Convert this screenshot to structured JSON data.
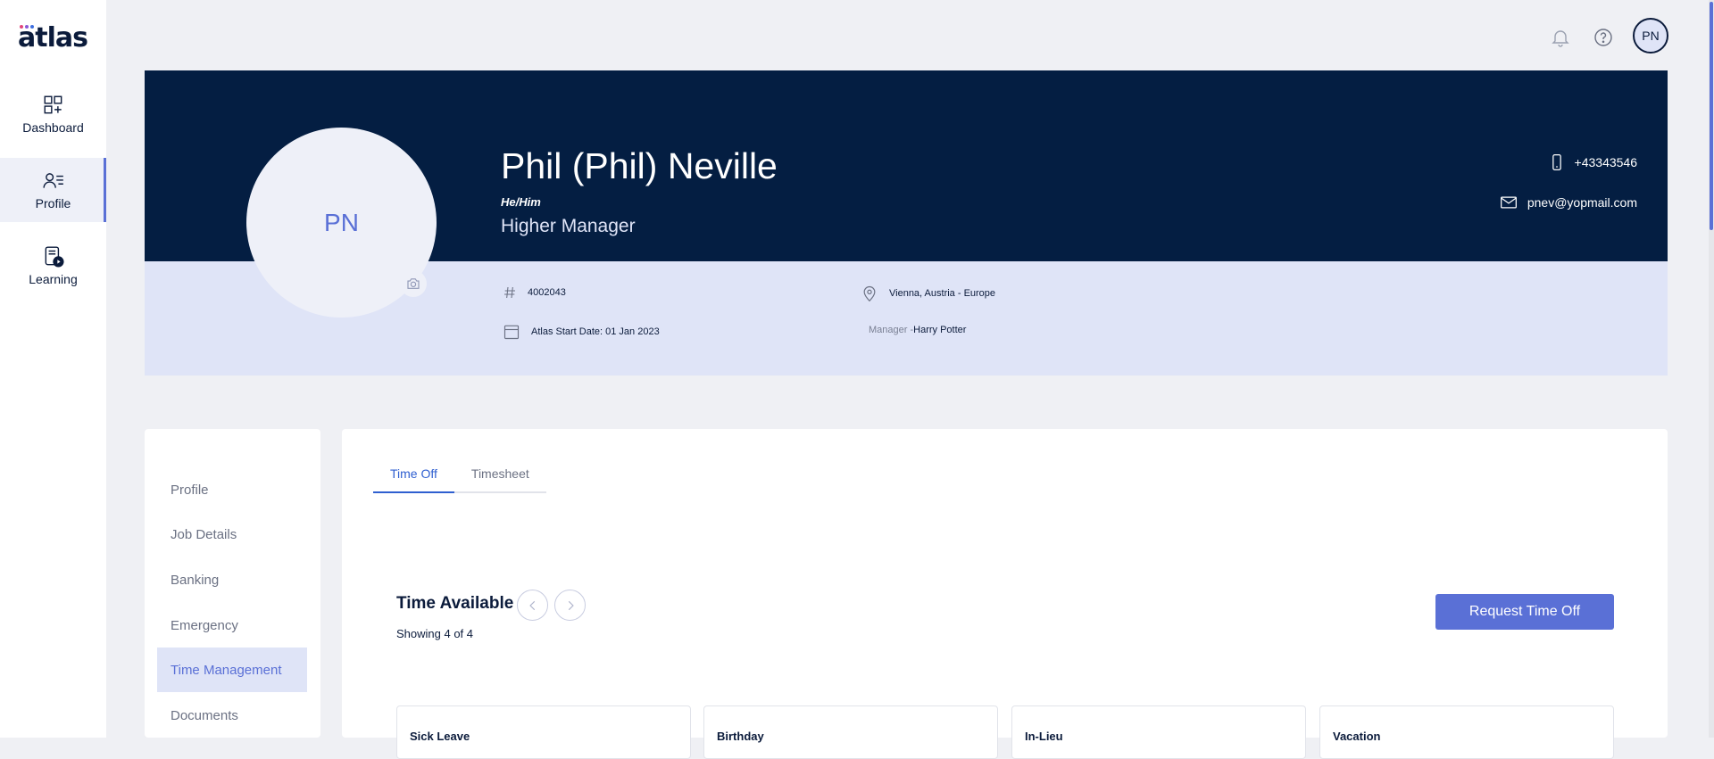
{
  "brand": {
    "logo_text": "atlas",
    "dot_colors": [
      "#e2457b",
      "#8a5ad8",
      "#3f6fe0"
    ]
  },
  "sidebar": {
    "items": [
      {
        "label": "Dashboard",
        "icon": "dashboard-icon",
        "active": false
      },
      {
        "label": "Profile",
        "icon": "profile-icon",
        "active": true
      },
      {
        "label": "Learning",
        "icon": "learning-icon",
        "active": false
      }
    ]
  },
  "topbar": {
    "notification_icon": "bell-icon",
    "help_icon": "help-icon",
    "avatar_initials": "PN"
  },
  "profile": {
    "initials": "PN",
    "name": "Phil (Phil) Neville",
    "pronouns": "He/Him",
    "job_title": "Higher Manager",
    "phone": "+43343546",
    "email": "pnev@yopmail.com",
    "employee_id": "4002043",
    "start_date": "Atlas Start Date: 01 Jan 2023",
    "location": "Vienna, Austria - Europe",
    "manager_label": "Manager - ",
    "manager_name": "Harry Potter"
  },
  "profile_menu": {
    "items": [
      {
        "label": "Profile",
        "active": false
      },
      {
        "label": "Job Details",
        "active": false
      },
      {
        "label": "Banking",
        "active": false
      },
      {
        "label": "Emergency",
        "active": false
      },
      {
        "label": "Time Management",
        "active": true
      },
      {
        "label": "Documents",
        "active": false
      }
    ]
  },
  "time_management": {
    "tabs": [
      {
        "label": "Time Off",
        "active": true
      },
      {
        "label": "Timesheet",
        "active": false
      }
    ],
    "section_title": "Time Available",
    "showing": "Showing 4 of 4",
    "request_button": "Request Time Off",
    "leave_types": [
      "Sick Leave",
      "Birthday",
      "In-Lieu",
      "Vacation"
    ]
  },
  "colors": {
    "accent": "#5a70d6",
    "banner_dark": "#041e42",
    "banner_light": "#dfe4f7",
    "tab_active": "#2f5fd0"
  }
}
